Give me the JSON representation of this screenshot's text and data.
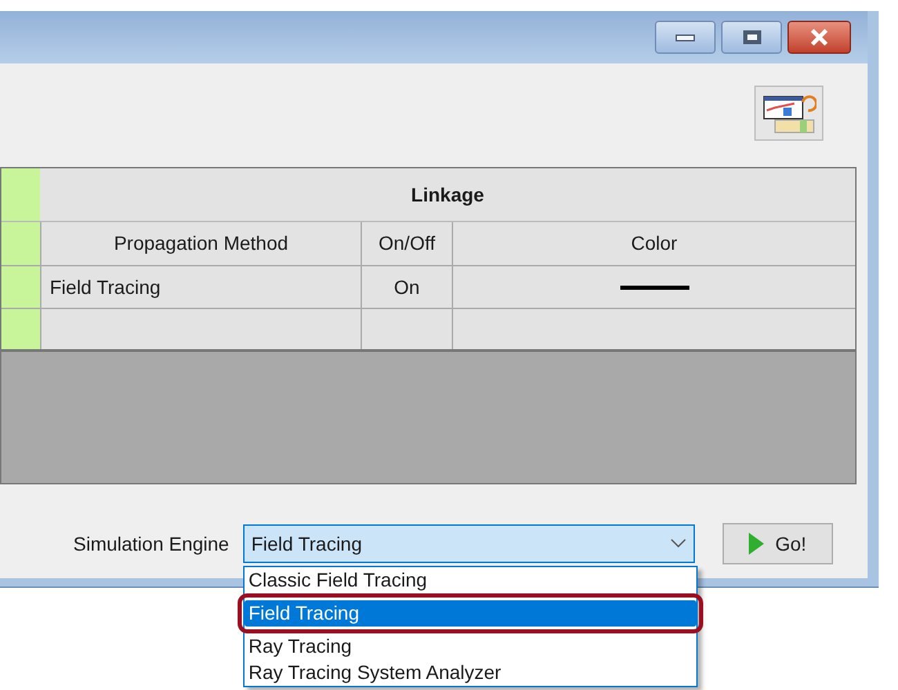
{
  "linkage_table": {
    "title": "Linkage",
    "columns": [
      "Propagation Method",
      "On/Off",
      "Color"
    ],
    "rows": [
      {
        "method": "Field Tracing",
        "on_off": "On",
        "color": "#000000"
      }
    ]
  },
  "simulation_engine": {
    "label": "Simulation Engine",
    "value": "Field Tracing",
    "expanded": true,
    "options": [
      {
        "label": "Classic Field Tracing",
        "selected": false,
        "highlighted": false
      },
      {
        "label": "Field Tracing",
        "selected": true,
        "highlighted": true
      },
      {
        "label": "Ray Tracing",
        "selected": false,
        "highlighted": false
      },
      {
        "label": "Ray Tracing System Analyzer",
        "selected": false,
        "highlighted": false
      }
    ]
  },
  "go_button": "Go!"
}
